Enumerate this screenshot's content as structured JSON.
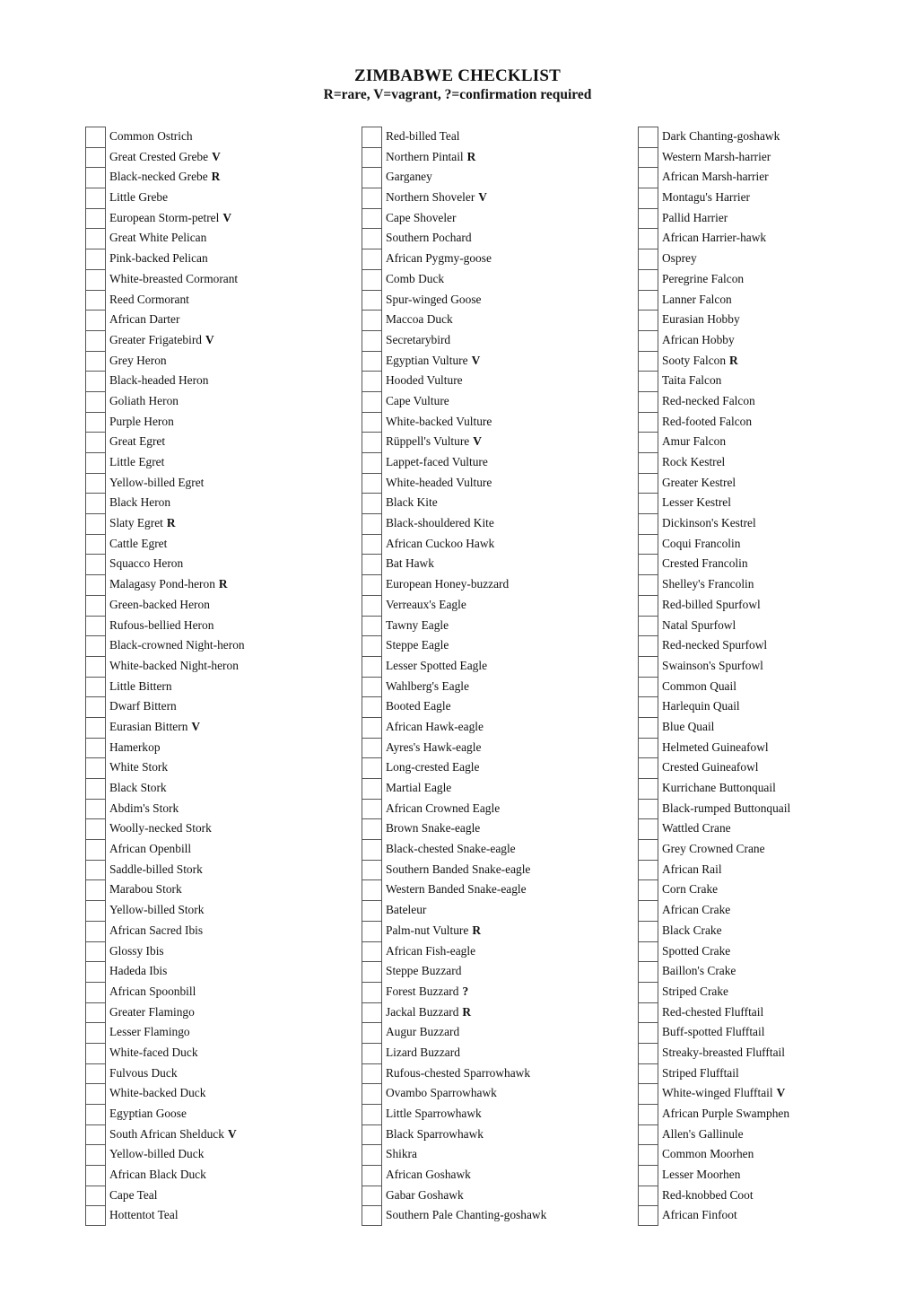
{
  "header": {
    "title": "ZIMBABWE CHECKLIST",
    "legend": "R=rare, V=vagrant, ?=confirmation required"
  },
  "columns": [
    {
      "items": [
        {
          "name": "Common Ostrich",
          "status": ""
        },
        {
          "name": "Great Crested Grebe",
          "status": "V"
        },
        {
          "name": "Black-necked Grebe",
          "status": "R"
        },
        {
          "name": "Little Grebe",
          "status": ""
        },
        {
          "name": "European Storm-petrel",
          "status": "V"
        },
        {
          "name": "Great White Pelican",
          "status": ""
        },
        {
          "name": "Pink-backed Pelican",
          "status": ""
        },
        {
          "name": "White-breasted Cormorant",
          "status": ""
        },
        {
          "name": "Reed Cormorant",
          "status": ""
        },
        {
          "name": "African Darter",
          "status": ""
        },
        {
          "name": "Greater Frigatebird",
          "status": "V"
        },
        {
          "name": "Grey Heron",
          "status": ""
        },
        {
          "name": "Black-headed Heron",
          "status": ""
        },
        {
          "name": "Goliath Heron",
          "status": ""
        },
        {
          "name": "Purple Heron",
          "status": ""
        },
        {
          "name": "Great Egret",
          "status": ""
        },
        {
          "name": "Little Egret",
          "status": ""
        },
        {
          "name": "Yellow-billed Egret",
          "status": ""
        },
        {
          "name": "Black Heron",
          "status": ""
        },
        {
          "name": "Slaty Egret",
          "status": "R"
        },
        {
          "name": "Cattle Egret",
          "status": ""
        },
        {
          "name": "Squacco Heron",
          "status": ""
        },
        {
          "name": "Malagasy Pond-heron",
          "status": "R"
        },
        {
          "name": "Green-backed Heron",
          "status": ""
        },
        {
          "name": "Rufous-bellied Heron",
          "status": ""
        },
        {
          "name": "Black-crowned Night-heron",
          "status": ""
        },
        {
          "name": "White-backed Night-heron",
          "status": ""
        },
        {
          "name": "Little Bittern",
          "status": ""
        },
        {
          "name": "Dwarf Bittern",
          "status": ""
        },
        {
          "name": "Eurasian Bittern",
          "status": "V"
        },
        {
          "name": "Hamerkop",
          "status": ""
        },
        {
          "name": "White Stork",
          "status": ""
        },
        {
          "name": "Black Stork",
          "status": ""
        },
        {
          "name": "Abdim's Stork",
          "status": ""
        },
        {
          "name": "Woolly-necked Stork",
          "status": ""
        },
        {
          "name": "African Openbill",
          "status": ""
        },
        {
          "name": "Saddle-billed Stork",
          "status": ""
        },
        {
          "name": "Marabou Stork",
          "status": ""
        },
        {
          "name": "Yellow-billed Stork",
          "status": ""
        },
        {
          "name": "African Sacred Ibis",
          "status": ""
        },
        {
          "name": "Glossy Ibis",
          "status": ""
        },
        {
          "name": "Hadeda Ibis",
          "status": ""
        },
        {
          "name": "African Spoonbill",
          "status": ""
        },
        {
          "name": "Greater Flamingo",
          "status": ""
        },
        {
          "name": "Lesser Flamingo",
          "status": ""
        },
        {
          "name": "White-faced Duck",
          "status": ""
        },
        {
          "name": "Fulvous Duck",
          "status": ""
        },
        {
          "name": "White-backed Duck",
          "status": ""
        },
        {
          "name": "Egyptian Goose",
          "status": ""
        },
        {
          "name": "South African Shelduck",
          "status": "V"
        },
        {
          "name": "Yellow-billed Duck",
          "status": ""
        },
        {
          "name": "African Black Duck",
          "status": ""
        },
        {
          "name": "Cape Teal",
          "status": ""
        },
        {
          "name": "Hottentot Teal",
          "status": ""
        }
      ]
    },
    {
      "items": [
        {
          "name": "Red-billed Teal",
          "status": ""
        },
        {
          "name": "Northern Pintail",
          "status": "R"
        },
        {
          "name": "Garganey",
          "status": ""
        },
        {
          "name": "Northern Shoveler",
          "status": "V"
        },
        {
          "name": "Cape Shoveler",
          "status": ""
        },
        {
          "name": "Southern Pochard",
          "status": ""
        },
        {
          "name": "African Pygmy-goose",
          "status": ""
        },
        {
          "name": "Comb Duck",
          "status": ""
        },
        {
          "name": "Spur-winged Goose",
          "status": ""
        },
        {
          "name": "Maccoa Duck",
          "status": ""
        },
        {
          "name": "Secretarybird",
          "status": ""
        },
        {
          "name": "Egyptian Vulture",
          "status": "V"
        },
        {
          "name": "Hooded Vulture",
          "status": ""
        },
        {
          "name": "Cape Vulture",
          "status": ""
        },
        {
          "name": "White-backed Vulture",
          "status": ""
        },
        {
          "name": "Rüppell's Vulture",
          "status": "V"
        },
        {
          "name": "Lappet-faced Vulture",
          "status": ""
        },
        {
          "name": "White-headed Vulture",
          "status": ""
        },
        {
          "name": "Black Kite",
          "status": ""
        },
        {
          "name": "Black-shouldered Kite",
          "status": ""
        },
        {
          "name": "African Cuckoo Hawk",
          "status": ""
        },
        {
          "name": "Bat Hawk",
          "status": ""
        },
        {
          "name": "European Honey-buzzard",
          "status": ""
        },
        {
          "name": "Verreaux's Eagle",
          "status": ""
        },
        {
          "name": "Tawny Eagle",
          "status": ""
        },
        {
          "name": "Steppe Eagle",
          "status": ""
        },
        {
          "name": "Lesser Spotted Eagle",
          "status": ""
        },
        {
          "name": "Wahlberg's Eagle",
          "status": ""
        },
        {
          "name": "Booted Eagle",
          "status": ""
        },
        {
          "name": "African Hawk-eagle",
          "status": ""
        },
        {
          "name": "Ayres's Hawk-eagle",
          "status": ""
        },
        {
          "name": "Long-crested Eagle",
          "status": ""
        },
        {
          "name": "Martial Eagle",
          "status": ""
        },
        {
          "name": "African Crowned Eagle",
          "status": ""
        },
        {
          "name": "Brown Snake-eagle",
          "status": ""
        },
        {
          "name": "Black-chested Snake-eagle",
          "status": ""
        },
        {
          "name": "Southern Banded Snake-eagle",
          "status": ""
        },
        {
          "name": "Western Banded Snake-eagle",
          "status": ""
        },
        {
          "name": "Bateleur",
          "status": ""
        },
        {
          "name": "Palm-nut Vulture",
          "status": "R"
        },
        {
          "name": "African Fish-eagle",
          "status": ""
        },
        {
          "name": "Steppe Buzzard",
          "status": ""
        },
        {
          "name": "Forest Buzzard",
          "status": "?"
        },
        {
          "name": "Jackal Buzzard",
          "status": "R"
        },
        {
          "name": "Augur Buzzard",
          "status": ""
        },
        {
          "name": "Lizard Buzzard",
          "status": ""
        },
        {
          "name": "Rufous-chested Sparrowhawk",
          "status": ""
        },
        {
          "name": "Ovambo Sparrowhawk",
          "status": ""
        },
        {
          "name": "Little Sparrowhawk",
          "status": ""
        },
        {
          "name": "Black Sparrowhawk",
          "status": ""
        },
        {
          "name": "Shikra",
          "status": ""
        },
        {
          "name": "African Goshawk",
          "status": ""
        },
        {
          "name": "Gabar Goshawk",
          "status": ""
        },
        {
          "name": "Southern Pale Chanting-goshawk",
          "status": ""
        }
      ]
    },
    {
      "items": [
        {
          "name": "Dark Chanting-goshawk",
          "status": ""
        },
        {
          "name": "Western Marsh-harrier",
          "status": ""
        },
        {
          "name": "African Marsh-harrier",
          "status": ""
        },
        {
          "name": "Montagu's Harrier",
          "status": ""
        },
        {
          "name": "Pallid Harrier",
          "status": ""
        },
        {
          "name": "African Harrier-hawk",
          "status": ""
        },
        {
          "name": "Osprey",
          "status": ""
        },
        {
          "name": "Peregrine Falcon",
          "status": ""
        },
        {
          "name": "Lanner Falcon",
          "status": ""
        },
        {
          "name": "Eurasian Hobby",
          "status": ""
        },
        {
          "name": "African Hobby",
          "status": ""
        },
        {
          "name": "Sooty Falcon",
          "status": "R"
        },
        {
          "name": "Taita Falcon",
          "status": ""
        },
        {
          "name": "Red-necked Falcon",
          "status": ""
        },
        {
          "name": "Red-footed Falcon",
          "status": ""
        },
        {
          "name": "Amur Falcon",
          "status": ""
        },
        {
          "name": "Rock Kestrel",
          "status": ""
        },
        {
          "name": "Greater Kestrel",
          "status": ""
        },
        {
          "name": "Lesser Kestrel",
          "status": ""
        },
        {
          "name": "Dickinson's Kestrel",
          "status": ""
        },
        {
          "name": "Coqui Francolin",
          "status": ""
        },
        {
          "name": "Crested Francolin",
          "status": ""
        },
        {
          "name": "Shelley's Francolin",
          "status": ""
        },
        {
          "name": "Red-billed Spurfowl",
          "status": ""
        },
        {
          "name": "Natal Spurfowl",
          "status": ""
        },
        {
          "name": "Red-necked Spurfowl",
          "status": ""
        },
        {
          "name": "Swainson's Spurfowl",
          "status": ""
        },
        {
          "name": "Common Quail",
          "status": ""
        },
        {
          "name": "Harlequin Quail",
          "status": ""
        },
        {
          "name": "Blue Quail",
          "status": ""
        },
        {
          "name": "Helmeted Guineafowl",
          "status": ""
        },
        {
          "name": "Crested Guineafowl",
          "status": ""
        },
        {
          "name": "Kurrichane Buttonquail",
          "status": ""
        },
        {
          "name": "Black-rumped Buttonquail",
          "status": ""
        },
        {
          "name": "Wattled Crane",
          "status": ""
        },
        {
          "name": "Grey Crowned Crane",
          "status": ""
        },
        {
          "name": "African Rail",
          "status": ""
        },
        {
          "name": "Corn Crake",
          "status": ""
        },
        {
          "name": "African Crake",
          "status": ""
        },
        {
          "name": "Black Crake",
          "status": ""
        },
        {
          "name": "Spotted Crake",
          "status": ""
        },
        {
          "name": "Baillon's Crake",
          "status": ""
        },
        {
          "name": "Striped Crake",
          "status": ""
        },
        {
          "name": "Red-chested Flufftail",
          "status": ""
        },
        {
          "name": "Buff-spotted Flufftail",
          "status": ""
        },
        {
          "name": "Streaky-breasted Flufftail",
          "status": ""
        },
        {
          "name": "Striped Flufftail",
          "status": ""
        },
        {
          "name": "White-winged Flufftail",
          "status": "V"
        },
        {
          "name": "African Purple Swamphen",
          "status": ""
        },
        {
          "name": "Allen's Gallinule",
          "status": ""
        },
        {
          "name": "Common Moorhen",
          "status": ""
        },
        {
          "name": "Lesser Moorhen",
          "status": ""
        },
        {
          "name": "Red-knobbed Coot",
          "status": ""
        },
        {
          "name": "African Finfoot",
          "status": ""
        }
      ]
    }
  ]
}
